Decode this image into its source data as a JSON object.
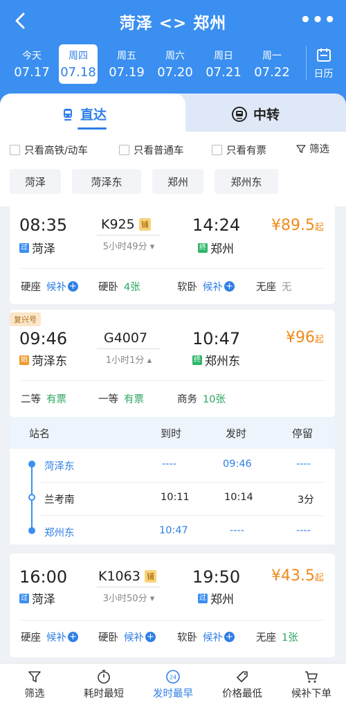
{
  "header": {
    "title": "菏泽 <> 郑州",
    "back_icon": "chevron-left-icon",
    "more": "•••"
  },
  "dates": [
    {
      "weekday": "今天",
      "date": "07.17"
    },
    {
      "weekday": "周四",
      "date": "07.18",
      "selected": true
    },
    {
      "weekday": "周五",
      "date": "07.19"
    },
    {
      "weekday": "周六",
      "date": "07.20"
    },
    {
      "weekday": "周日",
      "date": "07.21"
    },
    {
      "weekday": "周一",
      "date": "07.22"
    }
  ],
  "calendar": {
    "label": "日历"
  },
  "tabs": {
    "direct": "直达",
    "transfer": "中转"
  },
  "filters": {
    "high_speed": "只看高铁/动车",
    "normal": "只看普通车",
    "available": "只看有票",
    "screen": "筛选"
  },
  "station_chips": [
    "菏泽",
    "菏泽东",
    "郑州",
    "郑州东"
  ],
  "trains": [
    {
      "dep_time": "08:35",
      "dep_station": "菏泽",
      "dep_tag": "过",
      "train_no": "K925",
      "sleeper_tag": "铺",
      "duration": "5小时49分",
      "arr_time": "14:24",
      "arr_station": "郑州",
      "arr_tag": "终",
      "price": "¥89.5",
      "price_suffix": "起",
      "seats": [
        {
          "name": "硬座",
          "value": "候补"
        },
        {
          "name": "硬卧",
          "value": "4张"
        },
        {
          "name": "软卧",
          "value": "候补"
        },
        {
          "name": "无座",
          "value": "无"
        }
      ]
    },
    {
      "badge": "复兴号",
      "dep_time": "09:46",
      "dep_station": "菏泽东",
      "dep_tag": "始",
      "train_no": "G4007",
      "duration": "1小时1分",
      "arr_time": "10:47",
      "arr_station": "郑州东",
      "arr_tag": "终",
      "price": "¥96",
      "price_suffix": "起",
      "seats": [
        {
          "name": "二等",
          "value": "有票"
        },
        {
          "name": "一等",
          "value": "有票"
        },
        {
          "name": "商务",
          "value": "10张"
        }
      ]
    },
    {
      "dep_time": "16:00",
      "dep_station": "菏泽",
      "dep_tag": "过",
      "train_no": "K1063",
      "sleeper_tag": "铺",
      "duration": "3小时50分",
      "arr_time": "19:50",
      "arr_station": "郑州",
      "arr_tag": "过",
      "price": "¥43.5",
      "price_suffix": "起",
      "seats": [
        {
          "name": "硬座",
          "value": "候补"
        },
        {
          "name": "硬卧",
          "value": "候补"
        },
        {
          "name": "软卧",
          "value": "候补"
        },
        {
          "name": "无座",
          "value": "1张"
        }
      ]
    }
  ],
  "stops": {
    "headers": {
      "station": "站名",
      "arrive": "到时",
      "depart": "发时",
      "stay": "停留"
    },
    "rows": [
      {
        "station": "菏泽东",
        "arrive": "----",
        "depart": "09:46",
        "stay": "----"
      },
      {
        "station": "兰考南",
        "arrive": "10:11",
        "depart": "10:14",
        "stay": "3分"
      },
      {
        "station": "郑州东",
        "arrive": "10:47",
        "depart": "----",
        "stay": "----"
      }
    ]
  },
  "bottom_nav": [
    {
      "label": "筛选",
      "icon": "filter-icon"
    },
    {
      "label": "耗时最短",
      "icon": "timer-icon"
    },
    {
      "label": "发时最早",
      "icon": "clock-24-icon",
      "active": true,
      "badge": "24"
    },
    {
      "label": "价格最低",
      "icon": "price-tag-icon"
    },
    {
      "label": "候补下单",
      "icon": "cart-icon"
    }
  ],
  "colors": {
    "primary": "#3a8ff0",
    "price": "#f08a1c",
    "available": "#2aa55d"
  }
}
